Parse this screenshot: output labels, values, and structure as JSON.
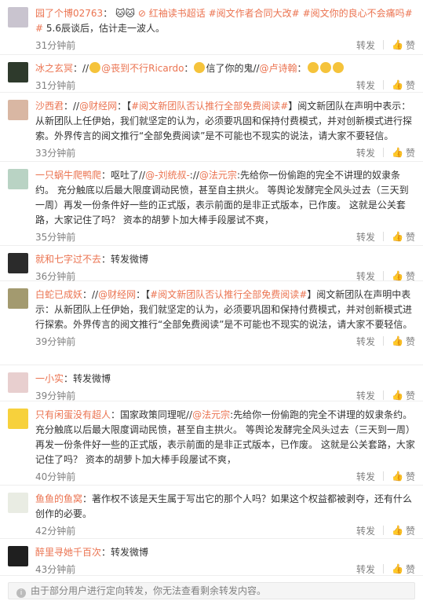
{
  "actions": {
    "forward": "转发",
    "like": "赞"
  },
  "comments": [
    {
      "user": "园了个博02763",
      "sep": "：",
      "segments": [
        "红袖读书超话",
        "#阅文作者合同大改#",
        "#阅文你的良心不会痛吗#",
        "5.6辰谈后，估计走一波人。"
      ],
      "time": "31分钟前",
      "avatar_color": "#c9c4cf"
    },
    {
      "user": "冰之玄冥",
      "sep": "：//",
      "mentions": [
        "@丧到不行Ricardo",
        "信了你的鬼//",
        "@卢诗翰"
      ],
      "time": "31分钟前",
      "avatar_color": "#2e3a2c"
    },
    {
      "user": "沙西君",
      "sep": "：//",
      "mention": "@财经网",
      "topic": "#阅文新团队否认推行全部免费阅读#",
      "text": "阅文新团队在声明中表示：从新团队上任伊始，我们就坚定的认为，必须要巩固和保持付费模式，并对创新模式进行探索。外界传言的阅文推行“全部免费阅读”是不可能也不现实的说法，请大家不要轻信。",
      "time": "33分钟前",
      "avatar_color": "#d9b7a3"
    },
    {
      "user": "一只蜗牛爬鸭爬",
      "sep": "：呕吐了//",
      "mentions": [
        "@-刘统叔-",
        "@法元宗"
      ],
      "text": "先给你一份偷跑的完全不讲理的奴隶条约。 充分触底以后最大限度调动民愤，甚至自主拱火。 等舆论发酵完全风头过去（三天到一周）再发一份条件好一些的正式版，表示前面的是非正式版本，已作废。 这就是公关套路，大家记住了吗？ 资本的胡萝卜加大棒手段屡试不爽，",
      "time": "35分钟前",
      "avatar_color": "#b9d3c4"
    },
    {
      "user": "就和七字过不去",
      "sep": "：",
      "text": "转发微博",
      "time": "36分钟前",
      "avatar_color": "#2b2b2b"
    },
    {
      "user": "白蛇已成妖",
      "sep": "：//",
      "mention": "@财经网",
      "topic": "#阅文新团队否认推行全部免费阅读#",
      "text": "阅文新团队在声明中表示：从新团队上任伊始，我们就坚定的认为，必须要巩固和保持付费模式，并对创新模式进行探索。外界传言的阅文推行“全部免费阅读”是不可能也不现实的说法，请大家不要轻信。",
      "time": "39分钟前",
      "avatar_color": "#a39a6f"
    },
    {
      "user": "一小实",
      "sep": "：",
      "text": "转发微博",
      "time": "39分钟前",
      "avatar_color": "#e8cfcf"
    },
    {
      "user": "只有闲蛋没有超人",
      "sep": "：国家政策同理呢//",
      "mentions": [
        "@法元宗"
      ],
      "text": "先给你一份偷跑的完全不讲理的奴隶条约。 充分触底以后最大限度调动民愤，甚至自主拱火。 等舆论发酵完全风头过去（三天到一周）再发一份条件好一些的正式版，表示前面的是非正式版本，已作废。 这就是公关套路，大家记住了吗？ 资本的胡萝卜加大棒手段屡试不爽，",
      "time": "40分钟前",
      "avatar_color": "#f7d13c"
    },
    {
      "user": "鱼鱼的鱼窝",
      "sep": "：",
      "text": "著作权不该是天生属于写出它的那个人吗？如果这个权益都被剥夺，还有什么创作的必要。",
      "time": "42分钟前",
      "avatar_color": "#e9ece3"
    },
    {
      "user": "醉里寻她千百次",
      "sep": "：",
      "text": "转发微博",
      "time": "43分钟前",
      "avatar_color": "#1f1f1f"
    }
  ],
  "notice": "由于部分用户进行定向转发，你无法查看剩余转发内容。"
}
